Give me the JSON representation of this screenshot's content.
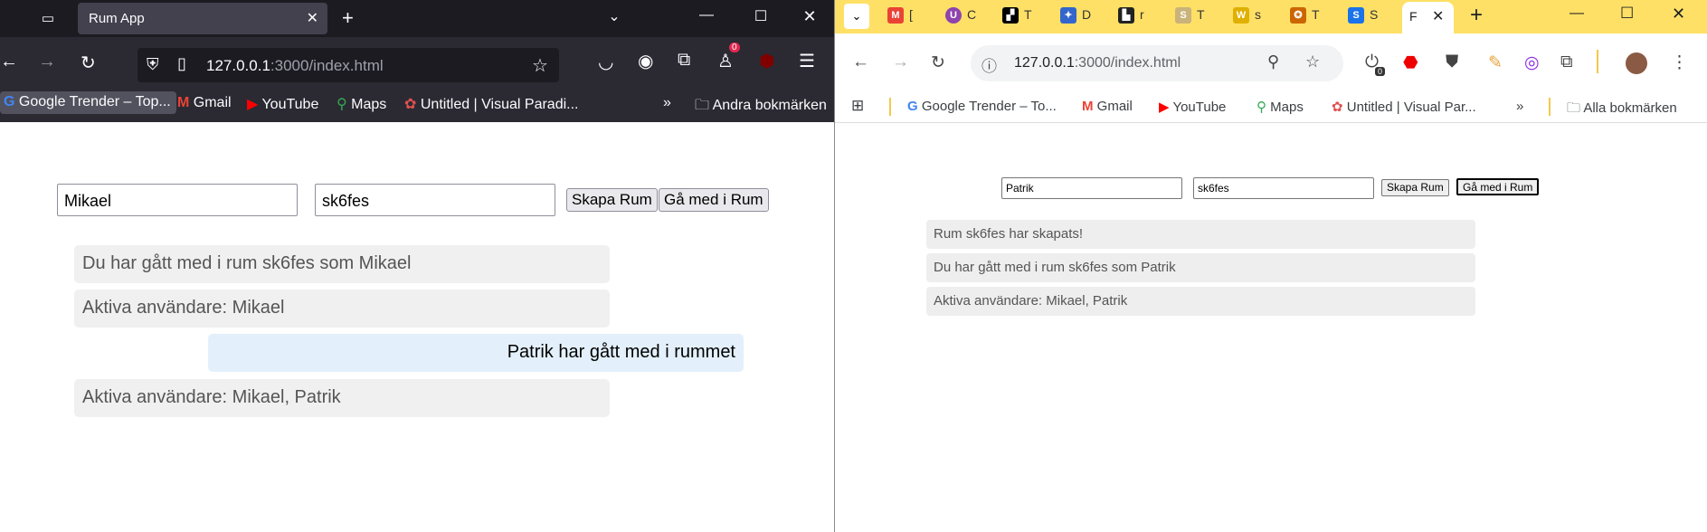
{
  "firefox": {
    "tab_title": "Rum App",
    "url_host": "127.0.0.1",
    "url_rest": ":3000/index.html",
    "ext_badge": "0",
    "bookmarks": [
      "Google Trender – Top...",
      "Gmail",
      "YouTube",
      "Maps",
      "Untitled | Visual Paradi..."
    ],
    "other_bookmarks": "Andra bokmärken",
    "app": {
      "name_value": "Mikael",
      "room_value": "sk6fes",
      "create_label": "Skapa Rum",
      "join_label": "Gå med i Rum",
      "messages": [
        "Du har gått med i rum sk6fes som Mikael",
        "Aktiva användare: Mikael",
        "Patrik har gått med i rummet",
        "Aktiva användare: Mikael, Patrik"
      ]
    }
  },
  "chrome": {
    "tabs": [
      {
        "letter": "[",
        "color": "#ea4335"
      },
      {
        "letter": "C",
        "color": "#8e44ad"
      },
      {
        "letter": "T",
        "color": "#000000"
      },
      {
        "letter": "D",
        "color": "#3366cc"
      },
      {
        "letter": "r",
        "color": "#222222"
      },
      {
        "letter": "T",
        "color": "#c9b37a"
      },
      {
        "letter": "s",
        "color": "#e0b000"
      },
      {
        "letter": "T",
        "color": "#cc6600"
      },
      {
        "letter": "S",
        "color": "#1a73e8"
      }
    ],
    "active_tab_letter": "F",
    "url_host": "127.0.0.1",
    "url_rest": ":3000/index.html",
    "ext_badge": "0",
    "bookmarks": [
      "Google Trender – To...",
      "Gmail",
      "YouTube",
      "Maps",
      "Untitled | Visual Par..."
    ],
    "all_bookmarks": "Alla bokmärken",
    "app": {
      "name_value": "Patrik",
      "room_value": "sk6fes",
      "create_label": "Skapa Rum",
      "join_label": "Gå med i Rum",
      "messages": [
        "Rum sk6fes har skapats!",
        "Du har gått med i rum sk6fes som Patrik",
        "Aktiva användare: Mikael, Patrik"
      ]
    }
  }
}
